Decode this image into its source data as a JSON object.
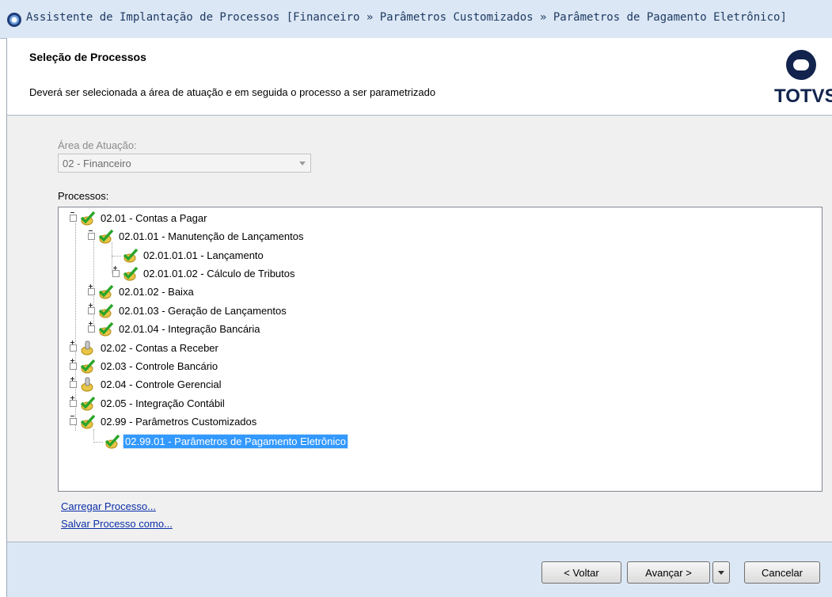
{
  "window": {
    "title": "Assistente de Implantação de Processos [Financeiro » Parâmetros Customizados  » Parâmetros de Pagamento Eletrônico]"
  },
  "header": {
    "title": "Seleção de Processos",
    "subtitle": "Deverá ser selecionada a área de atuação e em seguida o processo a ser parametrizado",
    "logo_text": "TOTVS"
  },
  "area": {
    "label": "Área de Atuação:",
    "value": "02 - Financeiro"
  },
  "processes": {
    "label": "Processos:",
    "items": [
      {
        "text": "02.01 - Contas a Pagar",
        "icon": "check-icon",
        "state": "expanded"
      },
      {
        "text": "02.01.01 - Manutenção de Lançamentos",
        "icon": "check-icon",
        "state": "expanded"
      },
      {
        "text": "02.01.01.01 - Lançamento",
        "icon": "check-icon",
        "state": "leaf"
      },
      {
        "text": "02.01.01.02 - Cálculo de Tributos",
        "icon": "check-icon",
        "state": "collapsed"
      },
      {
        "text": "02.01.02 - Baixa",
        "icon": "check-icon",
        "state": "collapsed"
      },
      {
        "text": "02.01.03 - Geração de Lançamentos",
        "icon": "check-icon",
        "state": "collapsed"
      },
      {
        "text": "02.01.04 - Integração Bancária",
        "icon": "check-icon",
        "state": "collapsed"
      },
      {
        "text": "02.02 - Contas a Receber",
        "icon": "pending-icon",
        "state": "collapsed"
      },
      {
        "text": "02.03 - Controle Bancário",
        "icon": "check-icon",
        "state": "collapsed"
      },
      {
        "text": "02.04 - Controle Gerencial",
        "icon": "pending-icon",
        "state": "collapsed"
      },
      {
        "text": "02.05 - Integração Contábil",
        "icon": "check-icon",
        "state": "collapsed"
      },
      {
        "text": "02.99 - Parâmetros Customizados",
        "icon": "check-icon",
        "state": "expanded"
      },
      {
        "text": "02.99.01 - Parâmetros de Pagamento Eletrônico",
        "icon": "check-icon",
        "state": "leaf",
        "selected": true
      }
    ]
  },
  "links": {
    "load": "Carregar Processo...",
    "save": "Salvar Processo como..."
  },
  "buttons": {
    "back": "< Voltar",
    "next": "Avançar >",
    "cancel": "Cancelar"
  },
  "colors": {
    "accent": "#3399ff",
    "check": "#2aa52a",
    "gear": "#e8c447",
    "logo": "#12244d"
  }
}
